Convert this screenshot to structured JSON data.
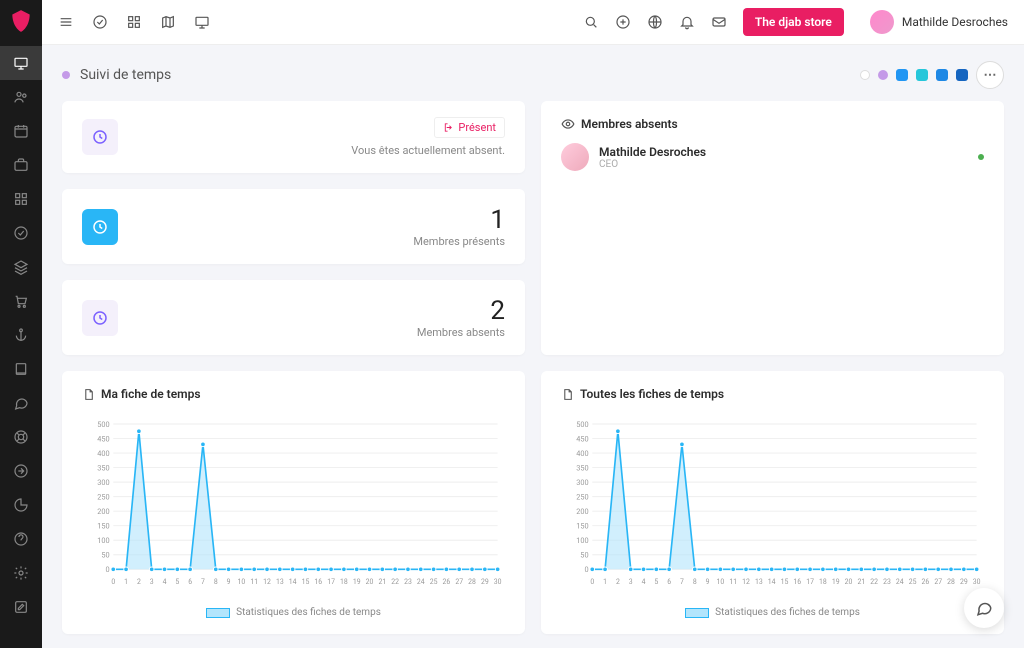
{
  "topbar": {
    "store_btn": "The djab store",
    "username": "Mathilde Desroches"
  },
  "page": {
    "title": "Suivi de temps",
    "chip_colors": [
      "#ffffff",
      "#c49ae8",
      "#2196f3",
      "#26c6da",
      "#1e88e5",
      "#1565c0"
    ]
  },
  "cards": {
    "presence": {
      "pill_label": "Présent",
      "sub": "Vous êtes actuellement absent."
    },
    "present_count": {
      "value": "1",
      "label": "Membres présents"
    },
    "absent_count": {
      "value": "2",
      "label": "Membres absents"
    },
    "absent_list": {
      "title": "Membres absents",
      "members": [
        {
          "name": "Mathilde Desroches",
          "role": "CEO"
        }
      ]
    },
    "chart1": {
      "title": "Ma fiche de temps",
      "legend": "Statistiques des fiches de temps"
    },
    "chart2": {
      "title": "Toutes les fiches de temps",
      "legend": "Statistiques des fiches de temps"
    }
  },
  "chart_data": [
    {
      "type": "line",
      "title": "Ma fiche de temps",
      "xlabel": "",
      "ylabel": "",
      "ylim": [
        0,
        500
      ],
      "yticks": [
        0,
        50,
        100,
        150,
        200,
        250,
        300,
        350,
        400,
        450,
        500
      ],
      "x": [
        0,
        1,
        2,
        3,
        4,
        5,
        6,
        7,
        8,
        9,
        10,
        11,
        12,
        13,
        14,
        15,
        16,
        17,
        18,
        19,
        20,
        21,
        22,
        23,
        24,
        25,
        26,
        27,
        28,
        29,
        30
      ],
      "series": [
        {
          "name": "Statistiques des fiches de temps",
          "values": [
            0,
            0,
            475,
            0,
            0,
            0,
            0,
            430,
            0,
            0,
            0,
            0,
            0,
            0,
            0,
            0,
            0,
            0,
            0,
            0,
            0,
            0,
            0,
            0,
            0,
            0,
            0,
            0,
            0,
            0,
            0
          ]
        }
      ]
    },
    {
      "type": "line",
      "title": "Toutes les fiches de temps",
      "xlabel": "",
      "ylabel": "",
      "ylim": [
        0,
        500
      ],
      "yticks": [
        0,
        50,
        100,
        150,
        200,
        250,
        300,
        350,
        400,
        450,
        500
      ],
      "x": [
        0,
        1,
        2,
        3,
        4,
        5,
        6,
        7,
        8,
        9,
        10,
        11,
        12,
        13,
        14,
        15,
        16,
        17,
        18,
        19,
        20,
        21,
        22,
        23,
        24,
        25,
        26,
        27,
        28,
        29,
        30
      ],
      "series": [
        {
          "name": "Statistiques des fiches de temps",
          "values": [
            0,
            0,
            475,
            0,
            0,
            0,
            0,
            430,
            0,
            0,
            0,
            0,
            0,
            0,
            0,
            0,
            0,
            0,
            0,
            0,
            0,
            0,
            0,
            0,
            0,
            0,
            0,
            0,
            0,
            0,
            0
          ]
        }
      ]
    }
  ]
}
